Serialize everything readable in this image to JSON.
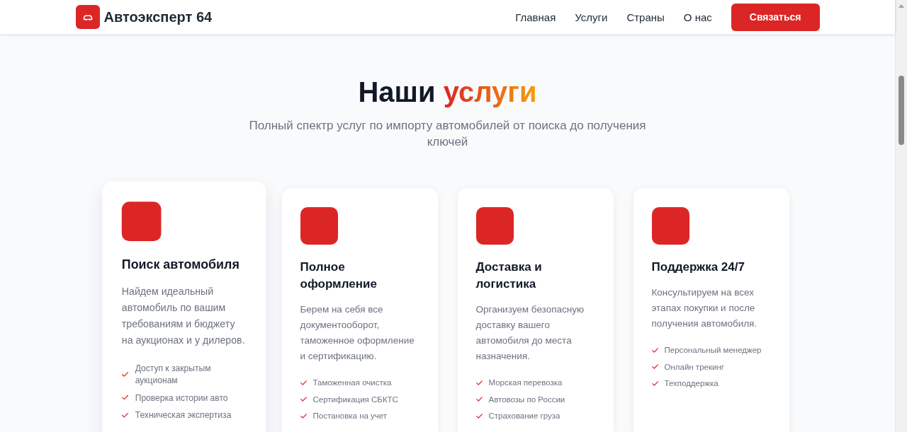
{
  "header": {
    "brand": "Автоэксперт 64",
    "nav": [
      {
        "label": "Главная"
      },
      {
        "label": "Услуги"
      },
      {
        "label": "Страны"
      },
      {
        "label": "О нас"
      }
    ],
    "cta": "Связаться"
  },
  "services": {
    "title": "Наши",
    "title_accent": "услуги",
    "subtitle": "Полный спектр услуг по импорту автомобилей от поиска до получения ключей",
    "cards": [
      {
        "title": "Поиск автомобиля",
        "description": "Найдем идеальный автомобиль по вашим требованиям и бюджету на аукционах и у дилеров.",
        "features": [
          "Доступ к закрытым аукционам",
          "Проверка истории авто",
          "Техническая экспертиза"
        ],
        "hovered": true
      },
      {
        "title": "Полное оформление",
        "description": "Берем на себя все документооборот, таможенное оформление и сертификацию.",
        "features": [
          "Таможенная очистка",
          "Сертификация СБКТС",
          "Постановка на учет"
        ],
        "hovered": false
      },
      {
        "title": "Доставка и логистика",
        "description": "Организуем безопасную доставку вашего автомобиля до места назначения.",
        "features": [
          "Морская перевозка",
          "Автовозы по России",
          "Страхование груза"
        ],
        "hovered": false
      },
      {
        "title": "Поддержка 24/7",
        "description": "Консультируем на всех этапах покупки и после получения автомобиля.",
        "features": [
          "Персональный менеджер",
          "Онлайн трекинг",
          "Техподдержка"
        ],
        "hovered": false
      }
    ]
  }
}
